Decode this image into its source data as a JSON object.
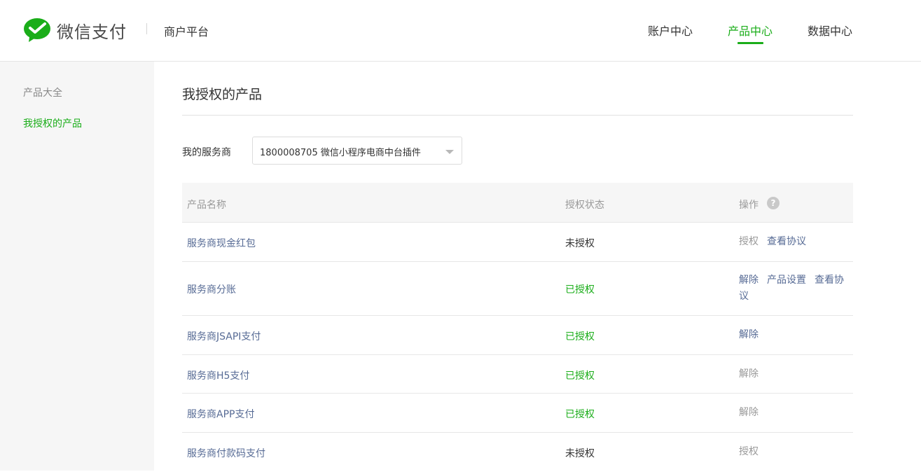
{
  "header": {
    "logo_text": "微信支付",
    "platform": "商户平台",
    "nav": {
      "account": "账户中心",
      "product": "产品中心",
      "data": "数据中心"
    },
    "accent_color": "#1aad19"
  },
  "sidebar": {
    "items": [
      {
        "label": "产品大全"
      },
      {
        "label": "我授权的产品"
      }
    ]
  },
  "main": {
    "title": "我授权的产品",
    "service_provider": {
      "label": "我的服务商",
      "selected": "1800008705 微信小程序电商中台插件"
    },
    "table": {
      "headers": {
        "name": "产品名称",
        "status": "授权状态",
        "ops": "操作"
      },
      "help_icon": "?",
      "rows": [
        {
          "name": "服务商现金红包",
          "status": "未授权",
          "op1": "授权",
          "op2": "查看协议"
        },
        {
          "name": "服务商分账",
          "status": "已授权",
          "op1": "解除",
          "op2": "产品设置",
          "op3": "查看协议"
        },
        {
          "name": "服务商JSAPI支付",
          "status": "已授权",
          "op1": "解除"
        },
        {
          "name": "服务商H5支付",
          "status": "已授权",
          "op1": "解除"
        },
        {
          "name": "服务商APP支付",
          "status": "已授权",
          "op1": "解除"
        },
        {
          "name": "服务商付款码支付",
          "status": "未授权",
          "op1": "授权"
        }
      ]
    }
  }
}
